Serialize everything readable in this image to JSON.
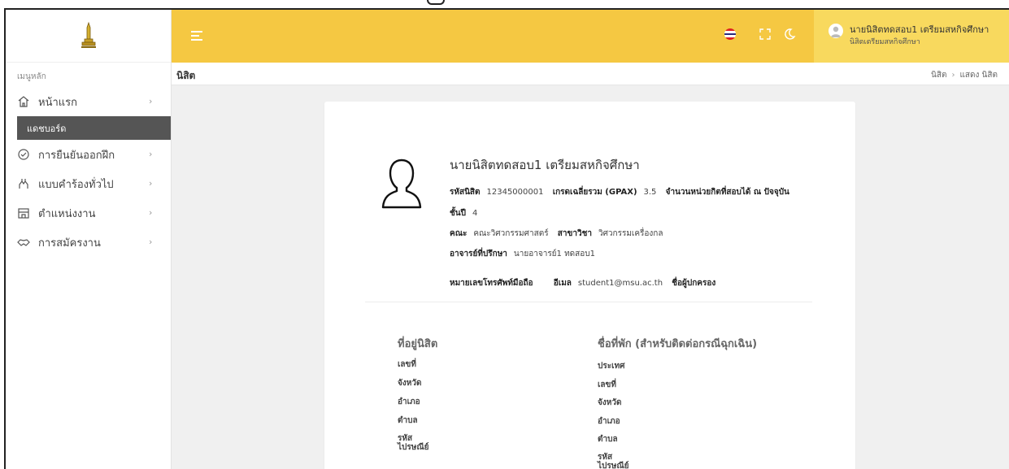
{
  "sidebar": {
    "menu_heading": "เมนูหลัก",
    "items": [
      {
        "label": "หน้าแรก",
        "icon": "home-icon"
      },
      {
        "label": "การยืนยันออกฝึก",
        "icon": "check-circle-icon"
      },
      {
        "label": "แบบคำร้องทั่วไป",
        "icon": "hands-icon"
      },
      {
        "label": "ตำแหน่งงาน",
        "icon": "building-icon"
      },
      {
        "label": "การสมัครงาน",
        "icon": "handshake-icon"
      }
    ],
    "active_submenu": "แดชบอร์ด"
  },
  "header": {
    "user_name": "นายนิสิตทดสอบ1 เตรียมสหกิจศึกษา",
    "user_role": "นิสิตเตรียมสหกิจศึกษา",
    "brand_color": "#f5c842"
  },
  "page": {
    "title": "นิสิต",
    "breadcrumb": [
      "นิสิต",
      "แสดง นิสิต"
    ]
  },
  "student": {
    "name": "นายนิสิตทดสอบ1 เตรียมสหกิจศึกษา",
    "id_label": "รหัสนิสิต",
    "id_value": "12345000001",
    "gpax_label": "เกรดเฉลี่ยรวม (GPAX)",
    "gpax_value": "3.5",
    "credits_label": "จำนวนหน่วยกิตที่สอบได้ ณ ปัจจุบัน",
    "year_label": "ชั้นปี",
    "year_value": "4",
    "faculty_label": "คณะ",
    "faculty_value": "คณะวิศวกรรมศาสตร์",
    "major_label": "สาขาวิชา",
    "major_value": "วิศวกรรมเครื่องกล",
    "advisor_label": "อาจารย์ที่ปรึกษา",
    "advisor_value": "นายอาจารย์1 ทดสอบ1",
    "phone_label": "หมายเลขโทรศัพท์มือถือ",
    "email_label": "อีเมล",
    "email_value": "student1@msu.ac.th",
    "guardian_label": "ชื่อผู้ปกครอง"
  },
  "address": {
    "title": "ที่อยู่นิสิต",
    "fields": [
      "เลขที่",
      "จังหวัด",
      "อำเภอ",
      "ตำบล",
      "รหัส\nไปรษณีย์"
    ]
  },
  "emergency": {
    "title": "ชื่อที่พัก (สำหรับติดต่อกรณีฉุกเฉิน)",
    "fields": [
      "ประเทศ",
      "เลขที่",
      "จังหวัด",
      "อำเภอ",
      "ตำบล",
      "รหัส\nไปรษณีย์"
    ]
  }
}
